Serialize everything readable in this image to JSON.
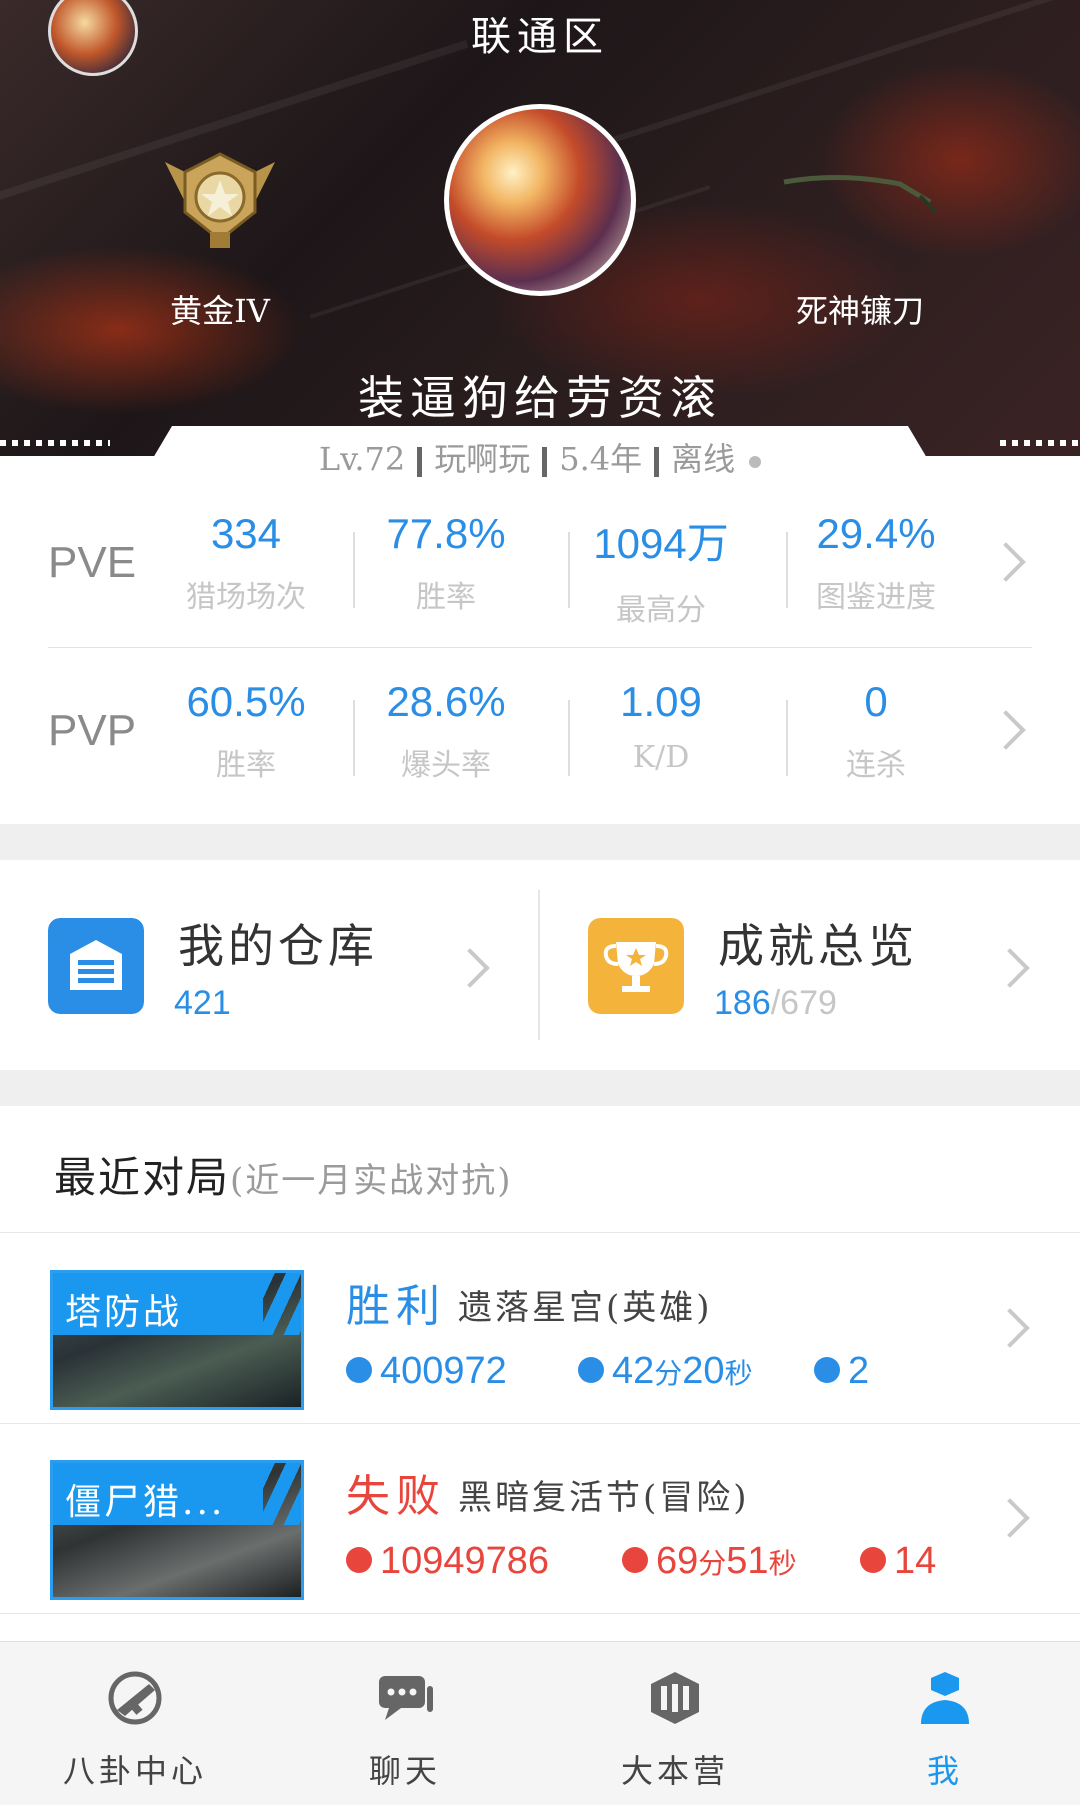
{
  "header": {
    "server": "联通区",
    "rank_label": "黄金IV",
    "weapon_label": "死神镰刀",
    "player_name": "装逼狗给劳资滚",
    "meta": {
      "level": "Lv.72",
      "tag": "玩啊玩",
      "years": "5.4年",
      "status": "离线"
    }
  },
  "pve": {
    "title": "PVE",
    "stats": [
      {
        "value": "334",
        "label": "猎场场次"
      },
      {
        "value": "77.8%",
        "label": "胜率"
      },
      {
        "value": "1094万",
        "label": "最高分"
      },
      {
        "value": "29.4%",
        "label": "图鉴进度"
      }
    ]
  },
  "pvp": {
    "title": "PVP",
    "stats": [
      {
        "value": "60.5%",
        "label": "胜率"
      },
      {
        "value": "28.6%",
        "label": "爆头率"
      },
      {
        "value": "1.09",
        "label": "K/D"
      },
      {
        "value": "0",
        "label": "连杀"
      }
    ]
  },
  "cards": {
    "warehouse": {
      "title": "我的仓库",
      "count": "421"
    },
    "achievements": {
      "title": "成就总览",
      "done": "186",
      "total": "/679"
    }
  },
  "recent": {
    "title": "最近对局",
    "hint": "(近一月实战对抗)",
    "matches": [
      {
        "mode": "塔防战",
        "result": "胜利",
        "map": "遗落星宫(英雄)",
        "score": "400972",
        "time_min": "42",
        "time_min_unit": "分",
        "time_sec": "20",
        "time_sec_unit": "秒",
        "deaths": "2"
      },
      {
        "mode": "僵尸猎...",
        "result": "失败",
        "map": "黑暗复活节(冒险)",
        "score": "10949786",
        "time_min": "69",
        "time_min_unit": "分",
        "time_sec": "51",
        "time_sec_unit": "秒",
        "deaths": "14"
      }
    ]
  },
  "tabbar": {
    "items": [
      {
        "label": "八卦中心",
        "icon": "gossip-icon"
      },
      {
        "label": "聊天",
        "icon": "chat-icon"
      },
      {
        "label": "大本营",
        "icon": "base-icon"
      },
      {
        "label": "我",
        "icon": "profile-icon"
      }
    ],
    "active": 3
  },
  "colors": {
    "accent_blue": "#2a8ee6",
    "lose_red": "#e8453c",
    "warehouse_icon": "#2a8ee6",
    "achievement_icon": "#f4b43b"
  }
}
